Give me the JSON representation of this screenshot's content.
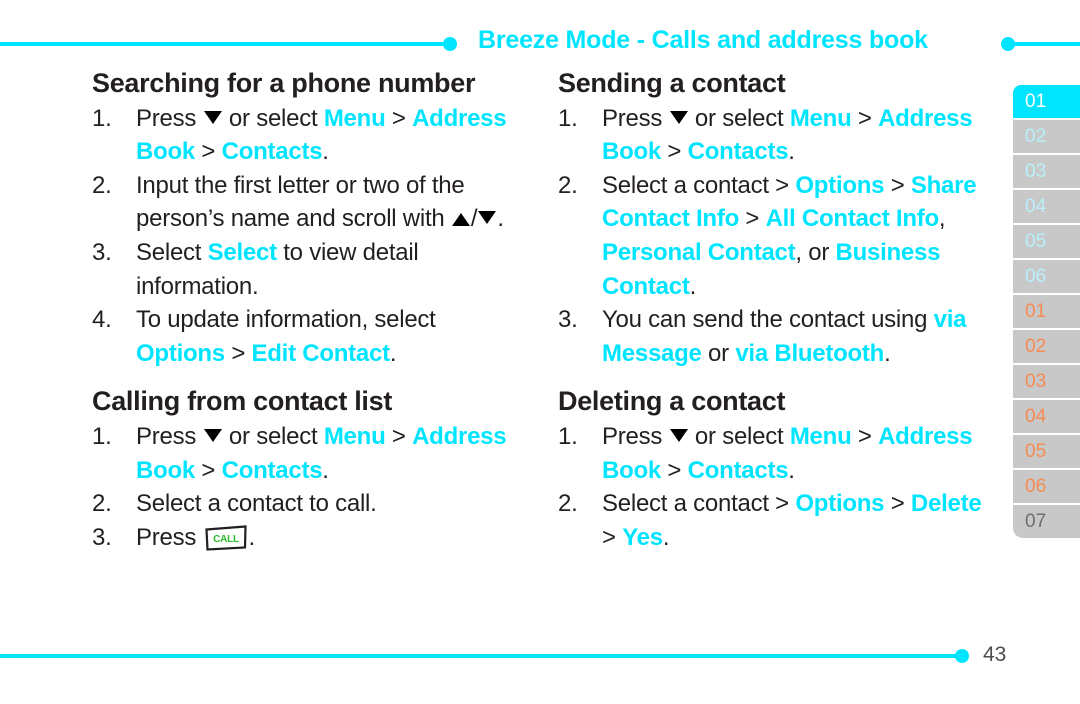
{
  "header": {
    "title": "Breeze Mode - Calls and address book",
    "accent_color": "#00e5ff"
  },
  "footer": {
    "page_number": "43"
  },
  "left_column": [
    {
      "title": "Searching for a phone number",
      "steps": [
        {
          "num": "1.",
          "parts": [
            {
              "t": "Press ",
              "s": "plain"
            },
            {
              "t": "[down-key]",
              "s": "key-down"
            },
            {
              "t": " or select ",
              "s": "plain"
            },
            {
              "t": "Menu",
              "s": "hl"
            },
            {
              "t": " > ",
              "s": "plain"
            },
            {
              "t": "Address Book",
              "s": "hl"
            },
            {
              "t": " > ",
              "s": "plain"
            },
            {
              "t": "Contacts",
              "s": "hl"
            },
            {
              "t": ".",
              "s": "plain"
            }
          ]
        },
        {
          "num": "2.",
          "parts": [
            {
              "t": "Input the first letter or two of the person’s name and scroll with ",
              "s": "plain"
            },
            {
              "t": "[up-key]",
              "s": "key-up"
            },
            {
              "t": "/",
              "s": "plain"
            },
            {
              "t": "[down-key]",
              "s": "key-down"
            },
            {
              "t": ".",
              "s": "plain"
            }
          ]
        },
        {
          "num": "3.",
          "parts": [
            {
              "t": "Select ",
              "s": "plain"
            },
            {
              "t": "Select",
              "s": "hl"
            },
            {
              "t": " to view detail information.",
              "s": "plain"
            }
          ]
        },
        {
          "num": "4.",
          "parts": [
            {
              "t": "To update information, select ",
              "s": "plain"
            },
            {
              "t": "Options",
              "s": "hl"
            },
            {
              "t": " > ",
              "s": "plain"
            },
            {
              "t": "Edit Contact",
              "s": "hl"
            },
            {
              "t": ".",
              "s": "plain"
            }
          ]
        }
      ]
    },
    {
      "title": "Calling from contact list",
      "steps": [
        {
          "num": "1.",
          "parts": [
            {
              "t": "Press ",
              "s": "plain"
            },
            {
              "t": "[down-key]",
              "s": "key-down"
            },
            {
              "t": " or select ",
              "s": "plain"
            },
            {
              "t": "Menu",
              "s": "hl"
            },
            {
              "t": " > ",
              "s": "plain"
            },
            {
              "t": "Address Book",
              "s": "hl"
            },
            {
              "t": " > ",
              "s": "plain"
            },
            {
              "t": "Contacts",
              "s": "hl"
            },
            {
              "t": ".",
              "s": "plain"
            }
          ]
        },
        {
          "num": "2.",
          "parts": [
            {
              "t": "Select a contact to call.",
              "s": "plain"
            }
          ]
        },
        {
          "num": "3.",
          "parts": [
            {
              "t": "Press ",
              "s": "plain"
            },
            {
              "t": "CALL",
              "s": "key-call"
            },
            {
              "t": ".",
              "s": "plain"
            }
          ]
        }
      ]
    }
  ],
  "right_column": [
    {
      "title": "Sending a contact",
      "steps": [
        {
          "num": "1.",
          "parts": [
            {
              "t": "Press ",
              "s": "plain"
            },
            {
              "t": "[down-key]",
              "s": "key-down"
            },
            {
              "t": " or select ",
              "s": "plain"
            },
            {
              "t": "Menu",
              "s": "hl"
            },
            {
              "t": " > ",
              "s": "plain"
            },
            {
              "t": "Address Book",
              "s": "hl"
            },
            {
              "t": " > ",
              "s": "plain"
            },
            {
              "t": "Contacts",
              "s": "hl"
            },
            {
              "t": ".",
              "s": "plain"
            }
          ]
        },
        {
          "num": "2.",
          "parts": [
            {
              "t": "Select a contact > ",
              "s": "plain"
            },
            {
              "t": "Options",
              "s": "hl"
            },
            {
              "t": " > ",
              "s": "plain"
            },
            {
              "t": "Share Contact Info",
              "s": "hl"
            },
            {
              "t": " > ",
              "s": "plain"
            },
            {
              "t": "All Contact Info",
              "s": "hl"
            },
            {
              "t": ", ",
              "s": "plain"
            },
            {
              "t": "Personal Contact",
              "s": "hl"
            },
            {
              "t": ", or ",
              "s": "plain"
            },
            {
              "t": "Business Contact",
              "s": "hl"
            },
            {
              "t": ".",
              "s": "plain"
            }
          ]
        },
        {
          "num": "3.",
          "parts": [
            {
              "t": "You can send the contact using ",
              "s": "plain"
            },
            {
              "t": "via Message",
              "s": "hl"
            },
            {
              "t": " or ",
              "s": "plain"
            },
            {
              "t": "via Bluetooth",
              "s": "hl"
            },
            {
              "t": ".",
              "s": "plain"
            }
          ]
        }
      ]
    },
    {
      "title": "Deleting a contact",
      "steps": [
        {
          "num": "1.",
          "parts": [
            {
              "t": "Press ",
              "s": "plain"
            },
            {
              "t": "[down-key]",
              "s": "key-down"
            },
            {
              "t": " or select ",
              "s": "plain"
            },
            {
              "t": "Menu",
              "s": "hl"
            },
            {
              "t": " > ",
              "s": "plain"
            },
            {
              "t": "Address Book",
              "s": "hl"
            },
            {
              "t": " > ",
              "s": "plain"
            },
            {
              "t": "Contacts",
              "s": "hl"
            },
            {
              "t": ".",
              "s": "plain"
            }
          ]
        },
        {
          "num": "2.",
          "parts": [
            {
              "t": "Select a contact > ",
              "s": "plain"
            },
            {
              "t": "Options",
              "s": "hl"
            },
            {
              "t": " > ",
              "s": "plain"
            },
            {
              "t": "Delete",
              "s": "hl"
            },
            {
              "t": " > ",
              "s": "plain"
            },
            {
              "t": "Yes",
              "s": "hl"
            },
            {
              "t": ".",
              "s": "plain"
            }
          ]
        }
      ]
    }
  ],
  "sidebar": {
    "tabs": [
      {
        "label": "01",
        "style": "active"
      },
      {
        "label": "02",
        "style": "cyan"
      },
      {
        "label": "03",
        "style": "cyan"
      },
      {
        "label": "04",
        "style": "cyan"
      },
      {
        "label": "05",
        "style": "cyan"
      },
      {
        "label": "06",
        "style": "cyan"
      },
      {
        "label": "01",
        "style": "orange"
      },
      {
        "label": "02",
        "style": "orange"
      },
      {
        "label": "03",
        "style": "orange"
      },
      {
        "label": "04",
        "style": "orange"
      },
      {
        "label": "05",
        "style": "orange"
      },
      {
        "label": "06",
        "style": "orange"
      },
      {
        "label": "07",
        "style": "gray"
      }
    ]
  },
  "icons": {
    "call_key_label": "CALL",
    "call_key_color": "#2dbb2d",
    "down_key": "triangle-down",
    "up_key": "triangle-up"
  }
}
